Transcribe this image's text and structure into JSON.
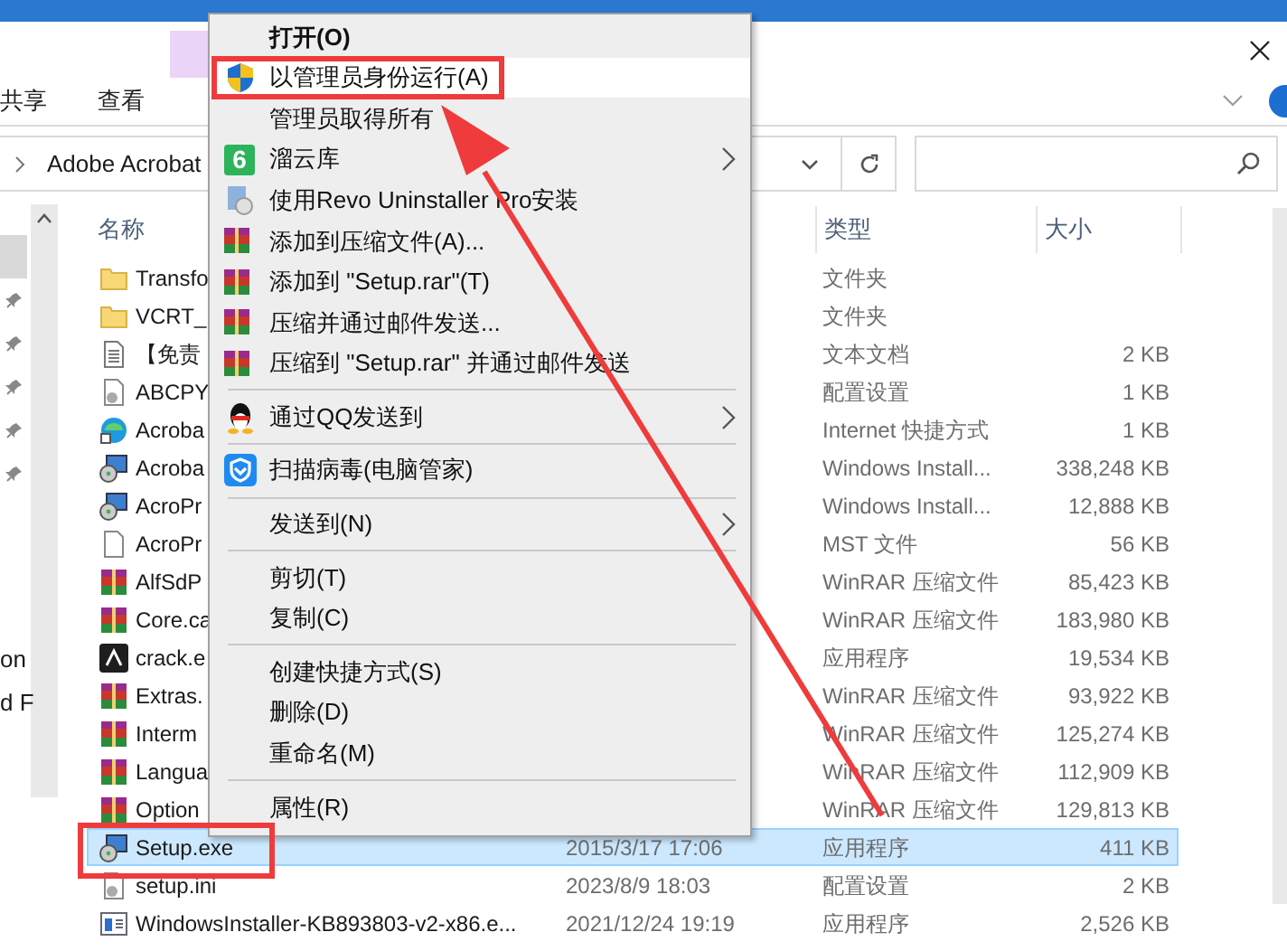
{
  "ribbon_tabs": [
    {
      "label": "共享"
    },
    {
      "label": "查看"
    }
  ],
  "address": {
    "path": "Adobe Acrobat"
  },
  "nav_pane": {
    "items": [
      {
        "selected": true,
        "pinned": false
      },
      {
        "selected": false,
        "pinned": true
      },
      {
        "selected": false,
        "pinned": true
      },
      {
        "selected": false,
        "pinned": true
      },
      {
        "selected": false,
        "pinned": true
      },
      {
        "selected": false,
        "pinned": true
      },
      {
        "selected": false,
        "pinned": false,
        "text": "on"
      },
      {
        "selected": false,
        "pinned": false,
        "text": "d F"
      }
    ]
  },
  "table": {
    "columns": [
      "名称",
      "类型",
      "大小"
    ],
    "rows": [
      {
        "name": "Transfo",
        "type": "文件夹",
        "kind": "folder",
        "selected": false
      },
      {
        "name": "VCRT_",
        "type": "文件夹",
        "kind": "folder",
        "selected": false
      },
      {
        "name": "【免责",
        "type": "文本文档",
        "size": "2 KB",
        "kind": "text",
        "selected": false
      },
      {
        "name": "ABCPY",
        "type": "配置设置",
        "size": "1 KB",
        "kind": "config",
        "selected": false
      },
      {
        "name": "Acroba",
        "type": "Internet 快捷方式",
        "size": "1 KB",
        "kind": "globe",
        "selected": false
      },
      {
        "name": "Acroba",
        "type": "Windows Install...",
        "size": "338,248 KB",
        "kind": "installer",
        "selected": false
      },
      {
        "name": "AcroPr",
        "type": "Windows Install...",
        "size": "12,888 KB",
        "kind": "installer",
        "selected": false
      },
      {
        "name": "AcroPr",
        "type": "MST 文件",
        "size": "56 KB",
        "kind": "file",
        "selected": false
      },
      {
        "name": "AlfSdP",
        "type": "WinRAR 压缩文件",
        "size": "85,423 KB",
        "kind": "archive",
        "selected": false
      },
      {
        "name": "Core.ca",
        "type": "WinRAR 压缩文件",
        "size": "183,980 KB",
        "kind": "archive",
        "selected": false
      },
      {
        "name": "crack.e",
        "type": "应用程序",
        "size": "19,534 KB",
        "kind": "pdf",
        "selected": false
      },
      {
        "name": "Extras.",
        "type": "WinRAR 压缩文件",
        "size": "93,922 KB",
        "kind": "archive",
        "selected": false
      },
      {
        "name": "Interm",
        "type": "WinRAR 压缩文件",
        "size": "125,274 KB",
        "kind": "archive",
        "selected": false
      },
      {
        "name": "Langua",
        "type": "WinRAR 压缩文件",
        "size": "112,909 KB",
        "kind": "archive",
        "selected": false
      },
      {
        "name": "Option",
        "type": "WinRAR 压缩文件",
        "size": "129,813 KB",
        "kind": "archive",
        "selected": false
      },
      {
        "name": "Setup.exe",
        "date": "2015/3/17 17:06",
        "type": "应用程序",
        "size": "411 KB",
        "kind": "installer",
        "selected": true
      },
      {
        "name": "setup.ini",
        "date": "2023/8/9 18:03",
        "type": "配置设置",
        "size": "2 KB",
        "kind": "config",
        "selected": false
      },
      {
        "name": "WindowsInstaller-KB893803-v2-x86.e...",
        "date": "2021/12/24 19:19",
        "type": "应用程序",
        "size": "2,526 KB",
        "kind": "window",
        "selected": false
      }
    ]
  },
  "context_menu": [
    {
      "kind": "plain",
      "label": "打开(O)",
      "bold": true,
      "highlighted": false,
      "submenu": false
    },
    {
      "kind": "shield",
      "label": "以管理员身份运行(A)",
      "bold": false,
      "highlighted": true,
      "submenu": false
    },
    {
      "kind": "plain",
      "label": "管理员取得所有",
      "bold": false,
      "highlighted": false,
      "submenu": false
    },
    {
      "kind": "tile",
      "label": "溜云库",
      "icon_text": "6",
      "bold": false,
      "highlighted": false,
      "submenu": true
    },
    {
      "kind": "disc",
      "label": "使用Revo Uninstaller Pro安装",
      "bold": false,
      "highlighted": false,
      "submenu": false
    },
    {
      "kind": "archive",
      "label": "添加到压缩文件(A)...",
      "bold": false,
      "highlighted": false,
      "submenu": false
    },
    {
      "kind": "archive",
      "label": "添加到 \"Setup.rar\"(T)",
      "bold": false,
      "highlighted": false,
      "submenu": false
    },
    {
      "kind": "archive",
      "label": "压缩并通过邮件发送...",
      "bold": false,
      "highlighted": false,
      "submenu": false
    },
    {
      "kind": "archive",
      "label": "压缩到 \"Setup.rar\" 并通过邮件发送",
      "bold": false,
      "highlighted": false,
      "submenu": false
    },
    {
      "kind": "separator"
    },
    {
      "kind": "penguin",
      "label": "通过QQ发送到",
      "bold": false,
      "highlighted": false,
      "submenu": true
    },
    {
      "kind": "separator"
    },
    {
      "kind": "guard",
      "label": "扫描病毒(电脑管家)",
      "bold": false,
      "highlighted": false,
      "submenu": false
    },
    {
      "kind": "separator"
    },
    {
      "kind": "plain",
      "label": "发送到(N)",
      "bold": false,
      "highlighted": false,
      "submenu": true
    },
    {
      "kind": "separator"
    },
    {
      "kind": "plain",
      "label": "剪切(T)",
      "bold": false,
      "highlighted": false,
      "submenu": false
    },
    {
      "kind": "plain",
      "label": "复制(C)",
      "bold": false,
      "highlighted": false,
      "submenu": false
    },
    {
      "kind": "separator"
    },
    {
      "kind": "plain",
      "label": "创建快捷方式(S)",
      "bold": false,
      "highlighted": false,
      "submenu": false
    },
    {
      "kind": "plain",
      "label": "删除(D)",
      "bold": false,
      "highlighted": false,
      "submenu": false
    },
    {
      "kind": "plain",
      "label": "重命名(M)",
      "bold": false,
      "highlighted": false,
      "submenu": false
    },
    {
      "kind": "separator"
    },
    {
      "kind": "plain",
      "label": "属性(R)",
      "bold": false,
      "highlighted": false,
      "submenu": false
    }
  ]
}
